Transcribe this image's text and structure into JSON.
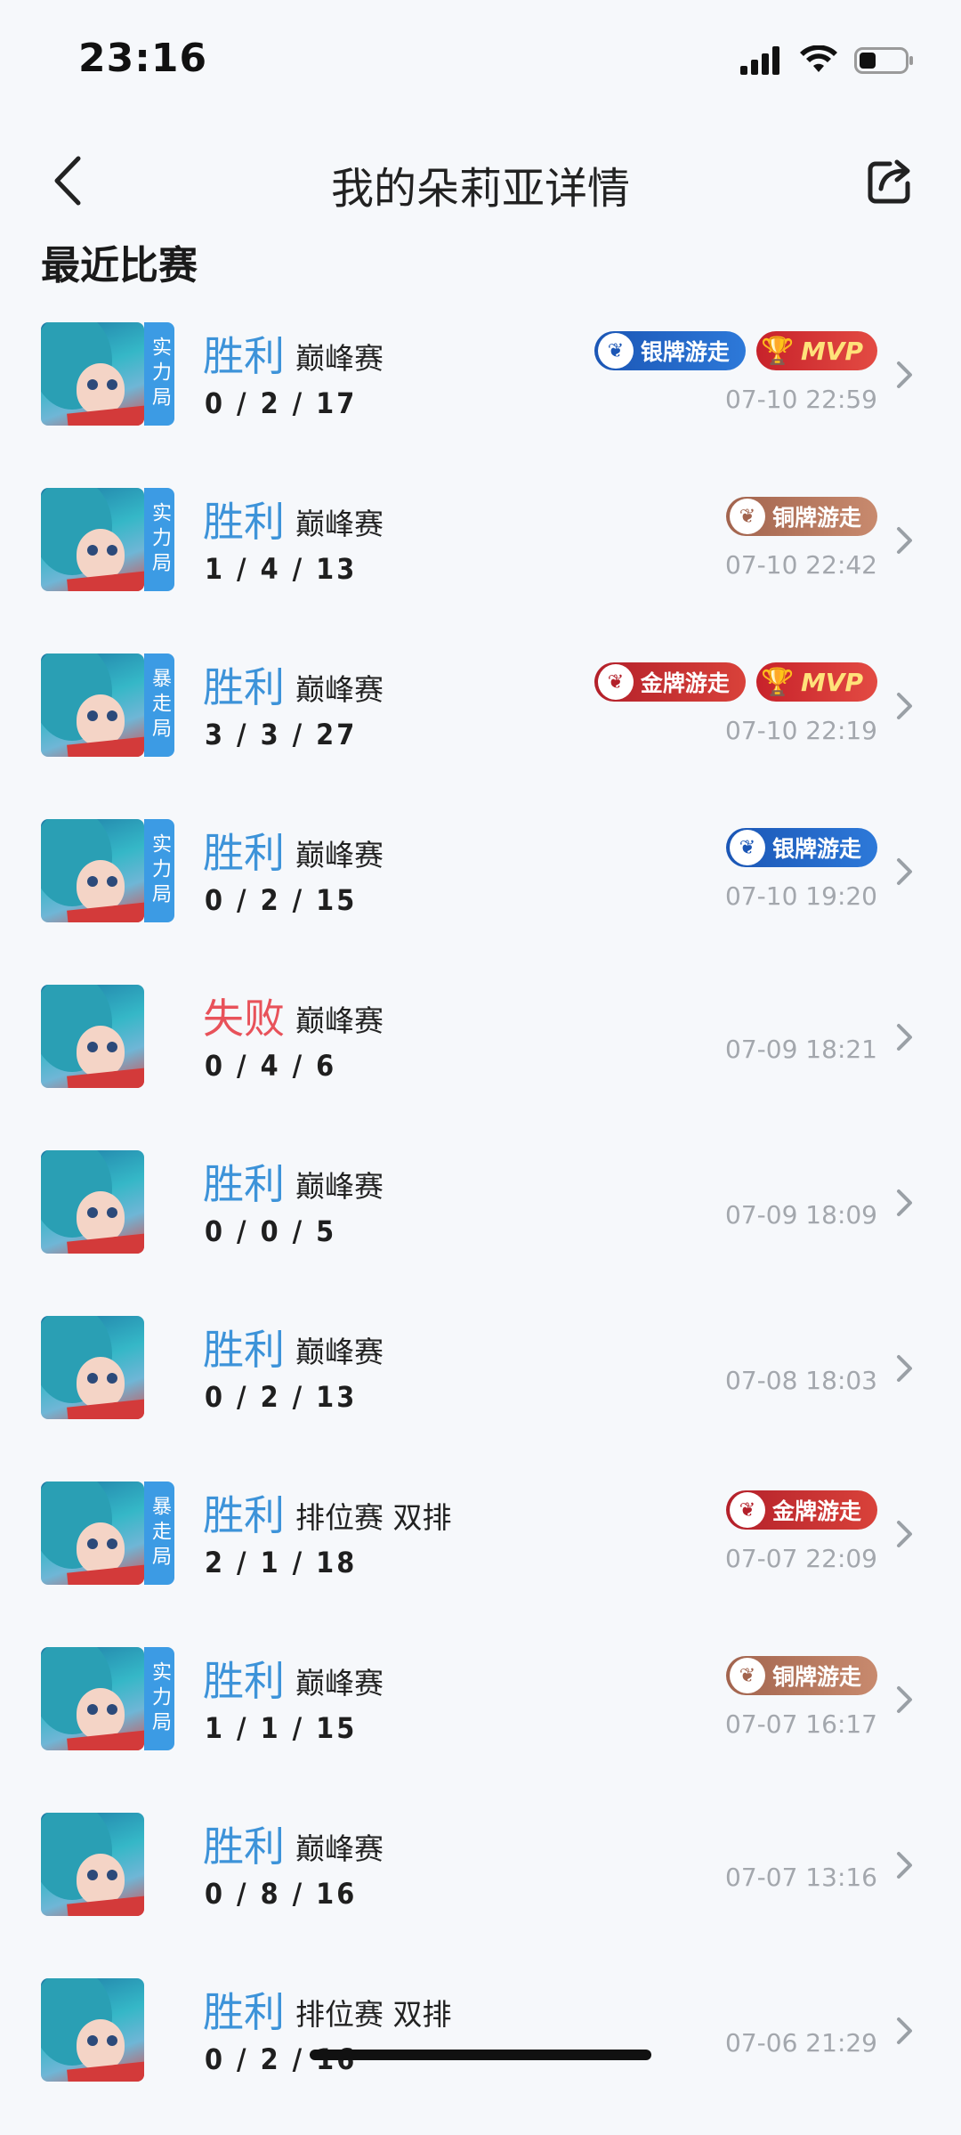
{
  "status_bar": {
    "time": "23:16"
  },
  "nav": {
    "title": "我的朵莉亚详情"
  },
  "section": {
    "title": "最近比赛"
  },
  "matches": [
    {
      "mode_tag": "实力局",
      "result": "胜利",
      "result_type": "win",
      "game_type": "巅峰赛",
      "kda": "0 / 2 / 17",
      "date": "07-10 22:59",
      "badges": [
        {
          "kind": "silver",
          "label": "银牌游走"
        },
        {
          "kind": "mvp",
          "label": "MVP"
        }
      ]
    },
    {
      "mode_tag": "实力局",
      "result": "胜利",
      "result_type": "win",
      "game_type": "巅峰赛",
      "kda": "1 / 4 / 13",
      "date": "07-10 22:42",
      "badges": [
        {
          "kind": "bronze",
          "label": "铜牌游走"
        }
      ]
    },
    {
      "mode_tag": "暴走局",
      "result": "胜利",
      "result_type": "win",
      "game_type": "巅峰赛",
      "kda": "3 / 3 / 27",
      "date": "07-10 22:19",
      "badges": [
        {
          "kind": "gold",
          "label": "金牌游走"
        },
        {
          "kind": "mvp",
          "label": "MVP"
        }
      ]
    },
    {
      "mode_tag": "实力局",
      "result": "胜利",
      "result_type": "win",
      "game_type": "巅峰赛",
      "kda": "0 / 2 / 15",
      "date": "07-10 19:20",
      "badges": [
        {
          "kind": "silver",
          "label": "银牌游走"
        }
      ]
    },
    {
      "mode_tag": "",
      "result": "失败",
      "result_type": "lose",
      "game_type": "巅峰赛",
      "kda": "0 / 4 / 6",
      "date": "07-09 18:21",
      "badges": []
    },
    {
      "mode_tag": "",
      "result": "胜利",
      "result_type": "win",
      "game_type": "巅峰赛",
      "kda": "0 / 0 / 5",
      "date": "07-09 18:09",
      "badges": []
    },
    {
      "mode_tag": "",
      "result": "胜利",
      "result_type": "win",
      "game_type": "巅峰赛",
      "kda": "0 / 2 / 13",
      "date": "07-08 18:03",
      "badges": []
    },
    {
      "mode_tag": "暴走局",
      "result": "胜利",
      "result_type": "win",
      "game_type": "排位赛 双排",
      "kda": "2 / 1 / 18",
      "date": "07-07 22:09",
      "badges": [
        {
          "kind": "gold",
          "label": "金牌游走"
        }
      ]
    },
    {
      "mode_tag": "实力局",
      "result": "胜利",
      "result_type": "win",
      "game_type": "巅峰赛",
      "kda": "1 / 1 / 15",
      "date": "07-07 16:17",
      "badges": [
        {
          "kind": "bronze",
          "label": "铜牌游走"
        }
      ]
    },
    {
      "mode_tag": "",
      "result": "胜利",
      "result_type": "win",
      "game_type": "巅峰赛",
      "kda": "0 / 8 / 16",
      "date": "07-07 13:16",
      "badges": []
    },
    {
      "mode_tag": "",
      "result": "胜利",
      "result_type": "win",
      "game_type": "排位赛 双排",
      "kda": "0 / 2 / 16",
      "date": "07-06 21:29",
      "badges": []
    }
  ],
  "icons": {
    "back": "chevron-left-icon",
    "share": "share-icon",
    "row_arrow": "chevron-right-icon",
    "badge_wing": "wing-emblem-icon",
    "mvp": "trophy-icon"
  },
  "colors": {
    "win": "#3d93d9",
    "lose": "#e8525a",
    "silver_badge": "#1b56b5",
    "gold_badge": "#b3202a",
    "bronze_badge": "#a2644e",
    "mode_tag": "#3c9be4"
  }
}
